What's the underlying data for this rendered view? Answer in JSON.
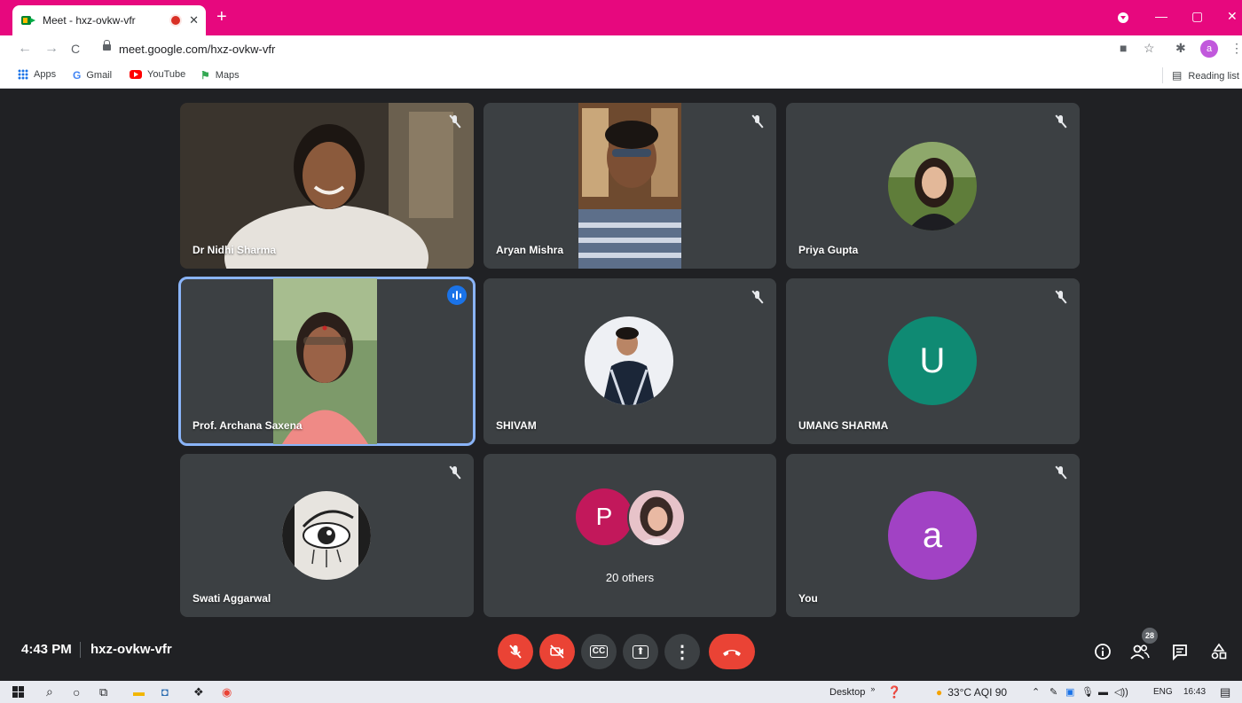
{
  "browser": {
    "tab_title": "Meet - hxz-ovkw-vfr",
    "close_glyph": "✕",
    "new_tab_glyph": "+",
    "window_controls": [
      "—",
      "▢",
      "✕"
    ],
    "url": "meet.google.com/hxz-ovkw-vfr",
    "nav": {
      "back": "←",
      "forward": "→",
      "reload": "C"
    },
    "profile_initial": "a",
    "bookmarks": [
      {
        "label": "Apps",
        "icon": "apps-grid-icon"
      },
      {
        "label": "Gmail",
        "icon": "google-g-icon"
      },
      {
        "label": "YouTube",
        "icon": "youtube-icon"
      },
      {
        "label": "Maps",
        "icon": "maps-icon"
      }
    ],
    "reading_list": "Reading list",
    "colors": {
      "frame": "#e7087e"
    }
  },
  "meeting": {
    "time": "4:43 PM",
    "code": "hxz-ovkw-vfr",
    "participants_count": "28",
    "participants": [
      {
        "name": "Dr Nidhi Sharma",
        "muted": true,
        "type": "video"
      },
      {
        "name": "Aryan Mishra",
        "muted": true,
        "type": "video"
      },
      {
        "name": "Priya Gupta",
        "muted": true,
        "type": "photo"
      },
      {
        "name": "Prof. Archana Saxena",
        "muted": false,
        "speaking": true,
        "type": "video"
      },
      {
        "name": "SHIVAM",
        "muted": true,
        "type": "photo"
      },
      {
        "name": "UMANG SHARMA",
        "muted": true,
        "type": "letter",
        "letter": "U",
        "color": "#0f8a73"
      },
      {
        "name": "Swati Aggarwal",
        "muted": true,
        "type": "photo"
      },
      {
        "name": "20 others",
        "type": "group",
        "letter": "P",
        "color": "#c2185b"
      },
      {
        "name": "You",
        "muted": true,
        "type": "letter",
        "letter": "a",
        "color": "#a142c4"
      }
    ],
    "controls": [
      {
        "name": "mic-off",
        "red": true
      },
      {
        "name": "camera-off",
        "red": true
      },
      {
        "name": "captions",
        "label": "CC"
      },
      {
        "name": "present",
        "label": "⬆"
      },
      {
        "name": "more",
        "label": "⋮"
      },
      {
        "name": "leave-call",
        "red": true
      }
    ]
  },
  "taskbar": {
    "desktop": "Desktop",
    "weather": "33°C  AQI 90",
    "language": "ENG",
    "clock": "16:43"
  }
}
